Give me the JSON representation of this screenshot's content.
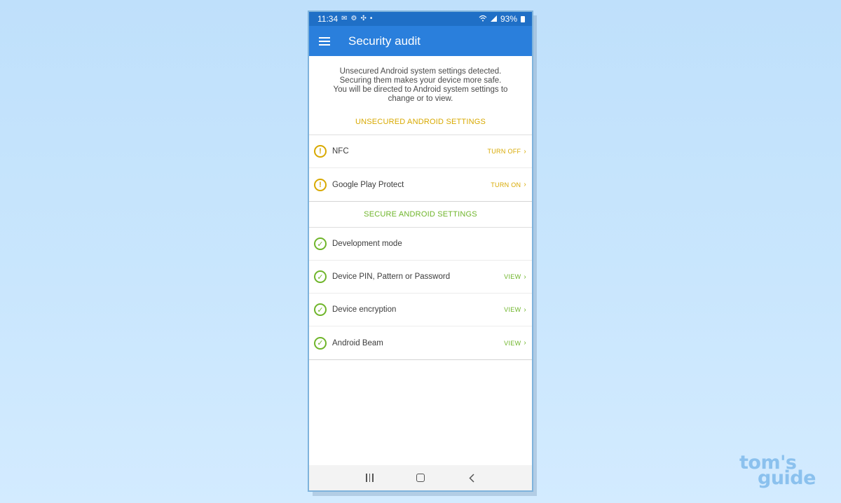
{
  "status_bar": {
    "time": "11:34",
    "left_icons": [
      "mail-icon",
      "gear-icon",
      "fan-icon",
      "dot-icon"
    ],
    "right_icons": [
      "wifi-icon",
      "signal-icon",
      "battery-icon"
    ],
    "battery": "93%"
  },
  "app_bar": {
    "title": "Security audit"
  },
  "intro": {
    "lines": [
      "Unsecured Android system settings detected.",
      "Securing them makes your device more safe.",
      "You will be directed to Android system settings to",
      "change or to view."
    ]
  },
  "unsecured": {
    "header": "UNSECURED ANDROID SETTINGS",
    "items": [
      {
        "label": "NFC",
        "action": "TURN OFF"
      },
      {
        "label": "Google Play Protect",
        "action": "TURN ON"
      }
    ]
  },
  "secure": {
    "header": "SECURE ANDROID SETTINGS",
    "items": [
      {
        "label": "Development mode",
        "action": ""
      },
      {
        "label": "Device PIN, Pattern or Password",
        "action": "VIEW"
      },
      {
        "label": "Device encryption",
        "action": "VIEW"
      },
      {
        "label": "Android Beam",
        "action": "VIEW"
      }
    ]
  },
  "icons": {
    "warning": "!",
    "check": "✓",
    "chevron": "›"
  },
  "colors": {
    "app_bar": "#2a7fdc",
    "status_bar": "#1f6fc6",
    "warning": "#d8a900",
    "secure": "#6fb52a"
  },
  "watermark": {
    "line1": "tom's",
    "line2": "guide"
  }
}
